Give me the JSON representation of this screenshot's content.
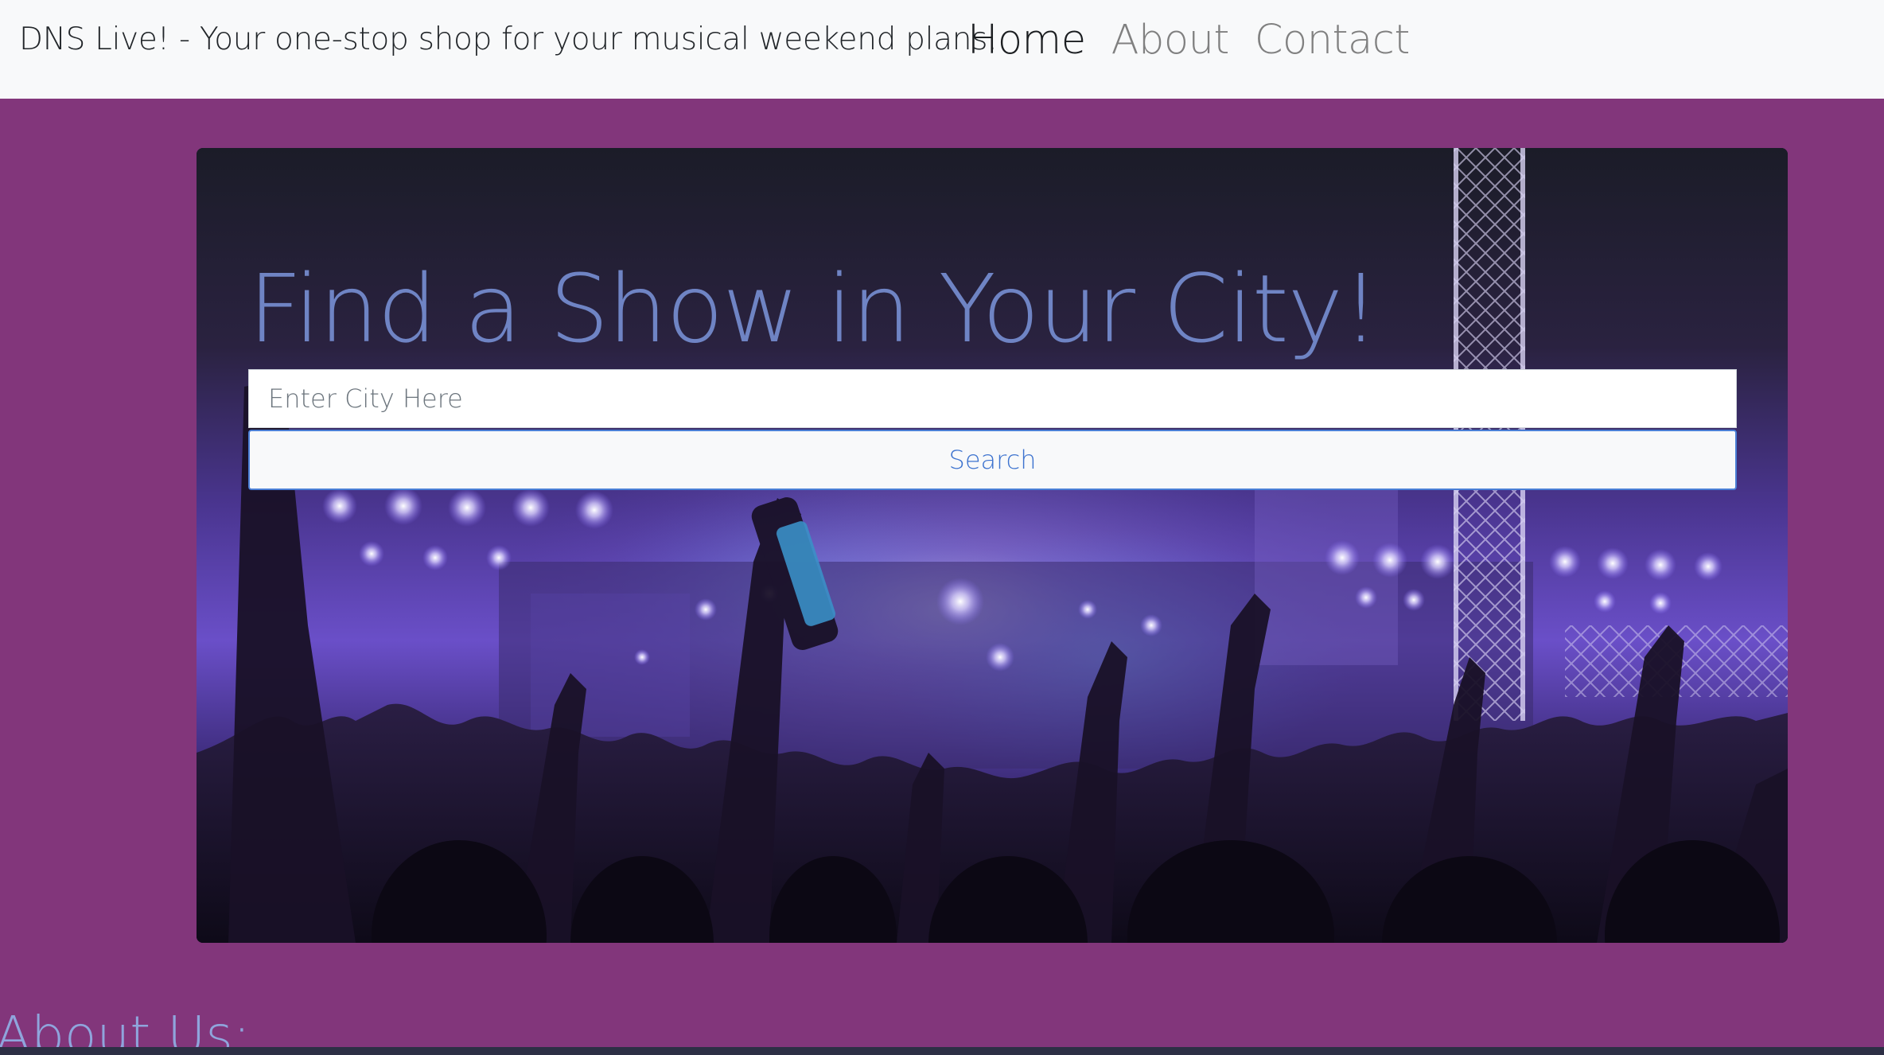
{
  "navbar": {
    "brand": "DNS Live! - Your one-stop shop for your musical weekend plans.",
    "links": [
      {
        "label": "Home",
        "active": true
      },
      {
        "label": "About",
        "active": false
      },
      {
        "label": "Contact",
        "active": false
      }
    ]
  },
  "hero": {
    "title": "Find a Show in Your City!",
    "search": {
      "placeholder": "Enter City Here",
      "value": "",
      "button_label": "Search"
    },
    "background": "concert-crowd-photo"
  },
  "about": {
    "heading": "About Us:"
  },
  "colors": {
    "page_background": "#82367b",
    "navbar_background": "#f8f9fa",
    "title_color": "#6f84c4",
    "button_text": "#3d73cf",
    "button_border": "#4a7fd6",
    "about_heading": "#8fa5dc"
  }
}
